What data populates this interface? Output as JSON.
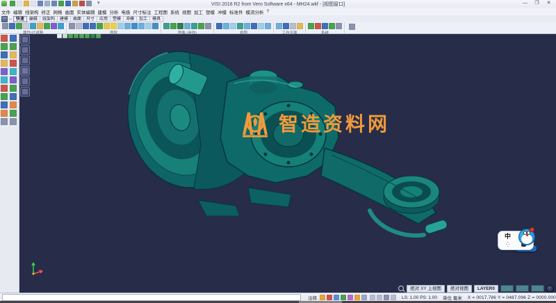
{
  "window": {
    "title": "VISI 2018 R2 from Vero Software x64 - MH24.wkf - [视图窗口]",
    "minimize": "—",
    "maximize": "❐",
    "close": "✕"
  },
  "quick_access": {
    "icons": [
      "#4aa14f",
      "#dfe4ee",
      "#e3b34c",
      "#dfe4ee",
      "#6e87b8",
      "#9fb0cc",
      "#6e87b8",
      "#4aa14f",
      "#3f6fb5",
      "#c9a04a",
      "#b5524a",
      "#8a93ab"
    ],
    "more": "▾"
  },
  "menu": {
    "items": [
      "文件",
      "编辑",
      "线架构",
      "修正",
      "网格",
      "曲面",
      "实体编辑",
      "建模",
      "分析",
      "电极",
      "尺寸标注",
      "工程图",
      "系统",
      "视图",
      "加工",
      "塑模",
      "冲模",
      "标准件",
      "模流分析",
      "?"
    ]
  },
  "tabs": {
    "dash": "‒",
    "items": [
      "快速",
      "编辑",
      "线架构",
      "建模",
      "曲面",
      "尺寸",
      "应用",
      "塑模",
      "冲模",
      "加工",
      "模具"
    ],
    "selected": "快速"
  },
  "ribbon": {
    "groups": [
      {
        "label": "属性/过滤器",
        "icons": [
          "#8a93ab",
          "#3f6fb5",
          "#4aa14f",
          "#c8ccd8",
          "#3fa0c9",
          "#e0b95c",
          "#4aa14f",
          "#7b61c9",
          "#3fa0c9"
        ]
      },
      {
        "label": "图层",
        "icons": [
          "#8a93ab",
          "#b5bdd0",
          "#3f6fb5",
          "#3f6fb5",
          "#4aa14f",
          "#e8c84b",
          "#f0d04b",
          "#9fd0e8",
          "#6fb0d8",
          "#3f90c9",
          "#6fb0d8",
          "#9fd0e8",
          "#3f90c9"
        ]
      },
      {
        "label": "图像 (迷你)",
        "icons": [
          "#3f9f8f",
          "#4aa14f",
          "#2f7d4f",
          "#6fb0d8",
          "#3f9f8f",
          "#4aa14f",
          "#8a93ab"
        ]
      },
      {
        "label": "视图",
        "icons": [
          "#3f6fb5",
          "#6fb0d8",
          "#9fd0e8",
          "#3f9f8f",
          "#6fb0d8",
          "#3f6fb5",
          "#9fd0e8",
          "#6fb0d8"
        ]
      },
      {
        "label": "工作平面",
        "icons": [
          "#6fb0d8",
          "#3f6fb5",
          "#b5bdd0",
          "#e0b95c"
        ]
      },
      {
        "label": "系统",
        "icons": [
          "#4aa14f",
          "#c9574a",
          "#3f6fb5",
          "#4aa14f",
          "#8a93ab"
        ]
      }
    ]
  },
  "left_toolbar": {
    "col1": [
      "#c9574a",
      "#4aa14f",
      "#3f6fb5",
      "#e0b95c",
      "#7b61c9",
      "#3fb5c9",
      "#c9574a",
      "#4aa14f",
      "#3f6fb5",
      "#e0894a",
      "#8a93ab"
    ],
    "col2": [
      "#3f6fb5",
      "#4aa14f",
      "#e0b95c",
      "#c9574a",
      "#3fb5c9",
      "#7b61c9",
      "#4aa14f",
      "#3f6fb5",
      "#e0894a",
      "#4aa14f",
      "#8a93ab"
    ]
  },
  "viewport": {
    "bg_color": "#272c49",
    "model_color": "#157a74",
    "side_icons": [
      "#3c4467",
      "#3c4467",
      "#3c4467",
      "#4a5278",
      "#3c4467",
      "#3c4467"
    ],
    "mini_icons": [
      "#e8edf5",
      "#bfe3c8",
      "#57a05f",
      "#4aa14f",
      "#57a05f",
      "#4aa14f",
      "#2f7d4f",
      "#57a05f"
    ],
    "watermark_text": "智造资料网",
    "watermark_color": "#f09a3b"
  },
  "ime": {
    "mode_label": "中",
    "moon": "☾",
    "dots": "⁛"
  },
  "status": {
    "view1": "绝对 XY 上视图",
    "view2": "绝对视图",
    "layer": "LAYER0",
    "swatches": [
      "#4f8492",
      "#4f8492",
      "#4f8492"
    ],
    "note": "注释",
    "note_icons": [
      "#e8a33d",
      "#c9574a",
      "#5a8fd0",
      "#4aa14f",
      "#b56bc9",
      "#e8a33d",
      "#9aa7c0"
    ],
    "view_icons": [
      "#b5bdd0",
      "#b5bdd0",
      "#8a93ab",
      "#b5bdd0"
    ],
    "ls": "LS: 1.00 PS: 1.00",
    "units": "单位 毫米",
    "coords": "X = 0017.786 Y = 0487.096 Z = 0000.000",
    "command_value": ""
  }
}
